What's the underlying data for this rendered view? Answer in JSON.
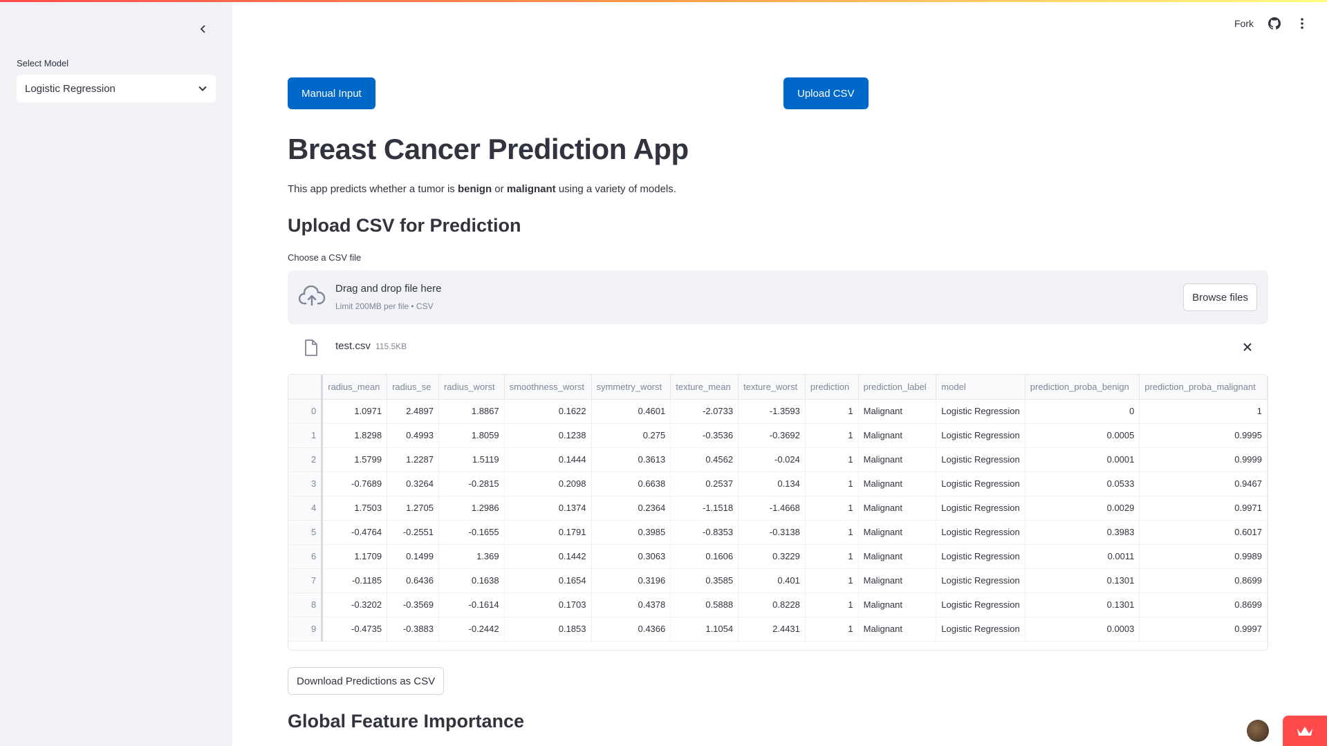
{
  "sidebar": {
    "select_label": "Select Model",
    "selected_model": "Logistic Regression"
  },
  "header": {
    "fork_label": "Fork"
  },
  "buttons": {
    "manual_input": "Manual Input",
    "upload_csv": "Upload CSV",
    "browse_files": "Browse files",
    "download": "Download Predictions as CSV"
  },
  "main": {
    "title": "Breast Cancer Prediction App",
    "desc_before": "This app predicts whether a tumor is ",
    "desc_benign": "benign",
    "desc_or": " or ",
    "desc_malignant": "malignant",
    "desc_after": " using a variety of models.",
    "upload_heading": "Upload CSV for Prediction",
    "file_label": "Choose a CSV file",
    "dropzone_title": "Drag and drop file here",
    "dropzone_sub": "Limit 200MB per file • CSV",
    "uploaded_name": "test.csv",
    "uploaded_size": "115.5KB",
    "feature_heading": "Global Feature Importance"
  },
  "table": {
    "columns": [
      "radius_mean",
      "radius_se",
      "radius_worst",
      "smoothness_worst",
      "symmetry_worst",
      "texture_mean",
      "texture_worst",
      "prediction",
      "prediction_label",
      "model",
      "prediction_proba_benign",
      "prediction_proba_malignant"
    ],
    "rows": [
      [
        "0",
        "1.0971",
        "2.4897",
        "1.8867",
        "0.1622",
        "0.4601",
        "-2.0733",
        "-1.3593",
        "1",
        "Malignant",
        "Logistic Regression",
        "0",
        "1"
      ],
      [
        "1",
        "1.8298",
        "0.4993",
        "1.8059",
        "0.1238",
        "0.275",
        "-0.3536",
        "-0.3692",
        "1",
        "Malignant",
        "Logistic Regression",
        "0.0005",
        "0.9995"
      ],
      [
        "2",
        "1.5799",
        "1.2287",
        "1.5119",
        "0.1444",
        "0.3613",
        "0.4562",
        "-0.024",
        "1",
        "Malignant",
        "Logistic Regression",
        "0.0001",
        "0.9999"
      ],
      [
        "3",
        "-0.7689",
        "0.3264",
        "-0.2815",
        "0.2098",
        "0.6638",
        "0.2537",
        "0.134",
        "1",
        "Malignant",
        "Logistic Regression",
        "0.0533",
        "0.9467"
      ],
      [
        "4",
        "1.7503",
        "1.2705",
        "1.2986",
        "0.1374",
        "0.2364",
        "-1.1518",
        "-1.4668",
        "1",
        "Malignant",
        "Logistic Regression",
        "0.0029",
        "0.9971"
      ],
      [
        "5",
        "-0.4764",
        "-0.2551",
        "-0.1655",
        "0.1791",
        "0.3985",
        "-0.8353",
        "-0.3138",
        "1",
        "Malignant",
        "Logistic Regression",
        "0.3983",
        "0.6017"
      ],
      [
        "6",
        "1.1709",
        "0.1499",
        "1.369",
        "0.1442",
        "0.3063",
        "0.1606",
        "0.3229",
        "1",
        "Malignant",
        "Logistic Regression",
        "0.0011",
        "0.9989"
      ],
      [
        "7",
        "-0.1185",
        "0.6436",
        "0.1638",
        "0.1654",
        "0.3196",
        "0.3585",
        "0.401",
        "1",
        "Malignant",
        "Logistic Regression",
        "0.1301",
        "0.8699"
      ],
      [
        "8",
        "-0.3202",
        "-0.3569",
        "-0.1614",
        "0.1703",
        "0.4378",
        "0.5888",
        "0.8228",
        "1",
        "Malignant",
        "Logistic Regression",
        "0.1301",
        "0.8699"
      ],
      [
        "9",
        "-0.4735",
        "-0.3883",
        "-0.2442",
        "0.1853",
        "0.4366",
        "1.1054",
        "2.4431",
        "1",
        "Malignant",
        "Logistic Regression",
        "0.0003",
        "0.9997"
      ]
    ]
  }
}
